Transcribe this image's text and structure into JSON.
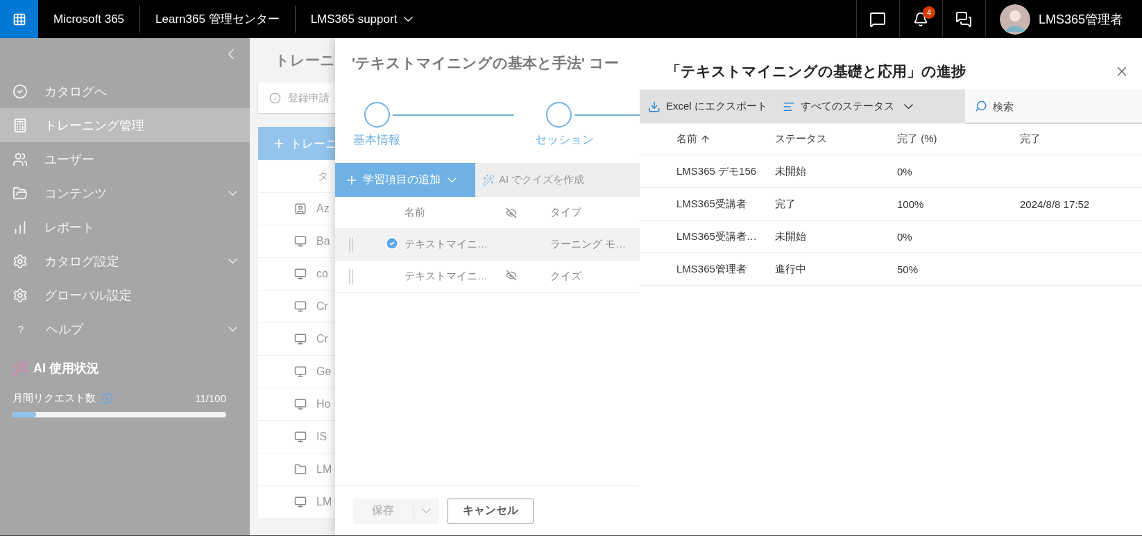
{
  "top_bar": {
    "app_name": "Microsoft 365",
    "admin_center": "Learn365 管理センター",
    "site": "LMS365 support",
    "notification_count": "4",
    "user_name": "LMS365管理者"
  },
  "sidebar": {
    "items": [
      {
        "label": "カタログへ",
        "kind": "check",
        "selected": false
      },
      {
        "label": "トレーニング管理",
        "kind": "calculator",
        "selected": true
      },
      {
        "label": "ユーザー",
        "kind": "users",
        "selected": false
      },
      {
        "label": "コンテンツ",
        "kind": "folder",
        "selected": false,
        "expanded": false
      },
      {
        "label": "レポート",
        "kind": "chart",
        "selected": false
      },
      {
        "label": "カタログ設定",
        "kind": "gear",
        "selected": false,
        "expanded": false
      },
      {
        "label": "グローバル設定",
        "kind": "appgear",
        "selected": false
      },
      {
        "label": "ヘルプ",
        "kind": "glyph",
        "glyph": "?",
        "selected": false,
        "expanded": false
      }
    ],
    "ai_usage": {
      "title": "AI 使用状況",
      "label": "月間リクエスト数",
      "reading": "11/100",
      "level": 0.11
    }
  },
  "background_page": {
    "title": "トレーニ",
    "info": "登録申請",
    "add_button": "トレーニ",
    "column_1": "タ",
    "rows": [
      {
        "kind": "person",
        "text": "Az"
      },
      {
        "kind": "monitor",
        "text": "Ba"
      },
      {
        "kind": "monitor",
        "text": "co"
      },
      {
        "kind": "monitor",
        "text": "Cr"
      },
      {
        "kind": "monitor",
        "text": "Cr"
      },
      {
        "kind": "monitor",
        "text": "Ge"
      },
      {
        "kind": "monitor",
        "text": "Ho"
      },
      {
        "kind": "monitor",
        "text": "IS"
      },
      {
        "kind": "folder",
        "text": "LM"
      },
      {
        "kind": "monitor",
        "text": "LM"
      }
    ]
  },
  "course_panel": {
    "title": "'テキストマイニングの基本と手法' コー",
    "steps": [
      {
        "label": "基本情報"
      },
      {
        "label": "セッション"
      }
    ],
    "add_button": "学習項目の追加",
    "ai_quiz_button": "AI でクイズを作成",
    "columns": [
      "名前",
      "タイプ"
    ],
    "rows": [
      {
        "name": "テキストマイニ…",
        "type": "ラーニング モ…",
        "selected": true,
        "hidden": false
      },
      {
        "name": "テキストマイニ…",
        "type": "クイズ",
        "selected": false,
        "hidden": true
      }
    ],
    "save_button": {
      "label": "保存",
      "disabled": true
    },
    "cancel_button": "キャンセル"
  },
  "progress_panel": {
    "title": "「テキストマイニングの基礎と応用」の進捗",
    "export_button": "Excel にエクスポート",
    "status_filter": "すべてのステータス",
    "search": {
      "placeholder": "検索"
    },
    "columns": [
      {
        "label": "名前",
        "sorted": true
      },
      {
        "label": "ステータス",
        "sorted": false
      },
      {
        "label": "完了 (%)",
        "sorted": false
      },
      {
        "label": "完了",
        "sorted": false
      }
    ],
    "rows": [
      {
        "name": "LMS365 デモ156",
        "status": "未開始",
        "percent": "0%"
      },
      {
        "name": "LMS365受講者",
        "status": "完了",
        "percent": "100%",
        "completed": "2024/8/8 17:52"
      },
      {
        "name": "LMS365受講者…",
        "status": "未開始",
        "percent": "0%"
      },
      {
        "name": "LMS365管理者",
        "status": "進行中",
        "percent": "50%"
      }
    ]
  }
}
